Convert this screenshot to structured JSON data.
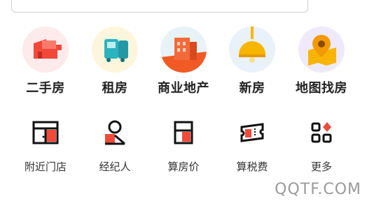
{
  "primary_services": [
    {
      "label": "二手房",
      "icon": "secondhand-house-icon"
    },
    {
      "label": "租房",
      "icon": "rent-truck-icon"
    },
    {
      "label": "商业地产",
      "icon": "commercial-building-icon"
    },
    {
      "label": "新房",
      "icon": "new-house-lamp-icon"
    },
    {
      "label": "地图找房",
      "icon": "map-pin-icon"
    }
  ],
  "secondary_services": [
    {
      "label": "附近门店",
      "icon": "store-icon"
    },
    {
      "label": "经纪人",
      "icon": "agent-icon"
    },
    {
      "label": "算房价",
      "icon": "calculator-icon"
    },
    {
      "label": "算税费",
      "icon": "tax-ticket-icon"
    },
    {
      "label": "更多",
      "icon": "more-grid-icon"
    }
  ],
  "watermark": "QQTF.COM",
  "colors": {
    "accent_red": "#f04b3a",
    "icon_black": "#111111",
    "search_border": "#cfcfcf"
  }
}
